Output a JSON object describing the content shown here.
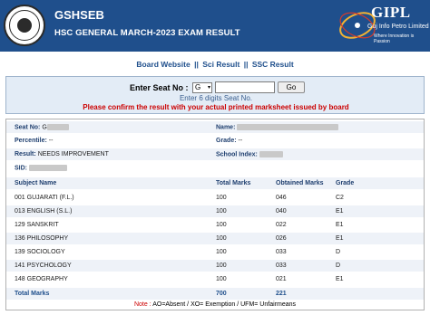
{
  "header": {
    "org": "GSHSEB",
    "title": "HSC GENERAL MARCH-2023 EXAM RESULT",
    "brand_logo": "GIPL",
    "brand_name": "Guj Info Petro Limited",
    "brand_tagline": "Where Innovation is Passion",
    "bg_color": "#1f4f8c"
  },
  "nav": {
    "board_website": "Board Website",
    "sci_result": "Sci Result",
    "ssc_result": "SSC Result",
    "separator": "||"
  },
  "seat_form": {
    "label": "Enter Seat No :",
    "series_value": "G",
    "go_label": "Go",
    "hint": "Enter 6 digits Seat No.",
    "warning": "Please confirm the result with your actual printed marksheet issued by board"
  },
  "result": {
    "seat_no_label": "Seat No:",
    "seat_no_value": "G",
    "name_label": "Name:",
    "percentile_label": "Percentile:",
    "percentile_value": "--",
    "grade_label": "Grade:",
    "grade_value": "--",
    "result_label": "Result:",
    "result_value": "NEEDS IMPROVEMENT",
    "school_index_label": "School Index:",
    "sid_label": "SID:",
    "columns": [
      "Subject Name",
      "Total Marks",
      "Obtained Marks",
      "Grade"
    ],
    "subjects": [
      {
        "name": "001 GUJARATI (F.L.)",
        "total": "100",
        "obtained": "046",
        "grade": "C2"
      },
      {
        "name": "013 ENGLISH (S.L.)",
        "total": "100",
        "obtained": "040",
        "grade": "E1"
      },
      {
        "name": "129 SANSKRIT",
        "total": "100",
        "obtained": "022",
        "grade": "E1"
      },
      {
        "name": "136 PHILOSOPHY",
        "total": "100",
        "obtained": "026",
        "grade": "E1"
      },
      {
        "name": "139 SOCIOLOGY",
        "total": "100",
        "obtained": "033",
        "grade": "D"
      },
      {
        "name": "141 PSYCHOLOGY",
        "total": "100",
        "obtained": "033",
        "grade": "D"
      },
      {
        "name": "148 GEOGRAPHY",
        "total": "100",
        "obtained": "021",
        "grade": "E1"
      }
    ],
    "total_label": "Total Marks",
    "total_marks": "700",
    "total_obtained": "221",
    "note_label": "Note :",
    "note_text": "AO=Absent / XO= Exemption / UFM= Unfairmeans"
  }
}
